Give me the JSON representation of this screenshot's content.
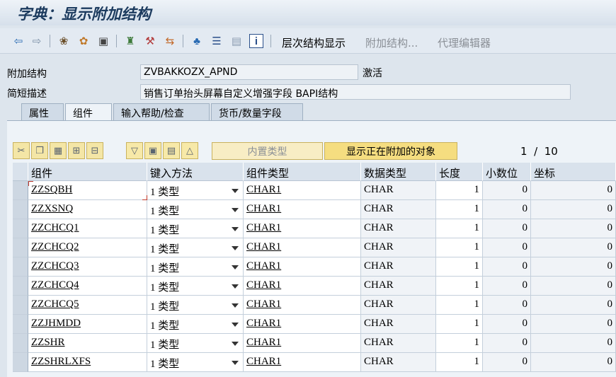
{
  "window": {
    "title": "字典：显示附加结构"
  },
  "toolbar": {
    "icons": [
      "back-arrow-icon",
      "forward-arrow-icon",
      "glasses-icon",
      "activate-icon",
      "object-list-icon",
      "hierarchy-icon",
      "wand-icon",
      "transport-icon",
      "tree-icon",
      "align-icon",
      "window-icon",
      "info-icon"
    ],
    "hierarchy_label": "层次结构显示",
    "append_label": "附加结构...",
    "proxy_label": "代理编辑器"
  },
  "form": {
    "append_label": "附加结构",
    "append_value": "ZVBAKKOZX_APND",
    "status": "激活",
    "desc_label": "简短描述",
    "desc_value": "销售订单抬头屏幕自定义增强字段 BAPI结构"
  },
  "tabs": [
    {
      "label": "属性"
    },
    {
      "label": "组件"
    },
    {
      "label": "输入帮助/检查"
    },
    {
      "label": "货币/数量字段"
    }
  ],
  "table_toolbar": {
    "builtin_type": "内置类型",
    "show_appended": "显示正在附加的对象",
    "page_current": "1",
    "page_sep": "/",
    "page_total": "10"
  },
  "table": {
    "headers": [
      "组件",
      "键入方法",
      "组件类型",
      "数据类型",
      "长度",
      "小数位",
      "坐标"
    ],
    "rows": [
      {
        "name": "ZZSQBH",
        "method": "1 类型",
        "comp": "CHAR1",
        "dtype": "CHAR",
        "len": "1",
        "dec": "0",
        "coord": "0"
      },
      {
        "name": "ZZXSNQ",
        "method": "1 类型",
        "comp": "CHAR1",
        "dtype": "CHAR",
        "len": "1",
        "dec": "0",
        "coord": "0"
      },
      {
        "name": "ZZCHCQ1",
        "method": "1 类型",
        "comp": "CHAR1",
        "dtype": "CHAR",
        "len": "1",
        "dec": "0",
        "coord": "0"
      },
      {
        "name": "ZZCHCQ2",
        "method": "1 类型",
        "comp": "CHAR1",
        "dtype": "CHAR",
        "len": "1",
        "dec": "0",
        "coord": "0"
      },
      {
        "name": "ZZCHCQ3",
        "method": "1 类型",
        "comp": "CHAR1",
        "dtype": "CHAR",
        "len": "1",
        "dec": "0",
        "coord": "0"
      },
      {
        "name": "ZZCHCQ4",
        "method": "1 类型",
        "comp": "CHAR1",
        "dtype": "CHAR",
        "len": "1",
        "dec": "0",
        "coord": "0"
      },
      {
        "name": "ZZCHCQ5",
        "method": "1 类型",
        "comp": "CHAR1",
        "dtype": "CHAR",
        "len": "1",
        "dec": "0",
        "coord": "0"
      },
      {
        "name": "ZZJHMDD",
        "method": "1 类型",
        "comp": "CHAR1",
        "dtype": "CHAR",
        "len": "1",
        "dec": "0",
        "coord": "0"
      },
      {
        "name": "ZZSHR",
        "method": "1 类型",
        "comp": "CHAR1",
        "dtype": "CHAR",
        "len": "1",
        "dec": "0",
        "coord": "0"
      },
      {
        "name": "ZZSHRLXFS",
        "method": "1 类型",
        "comp": "CHAR1",
        "dtype": "CHAR",
        "len": "1",
        "dec": "0",
        "coord": "0"
      }
    ]
  }
}
